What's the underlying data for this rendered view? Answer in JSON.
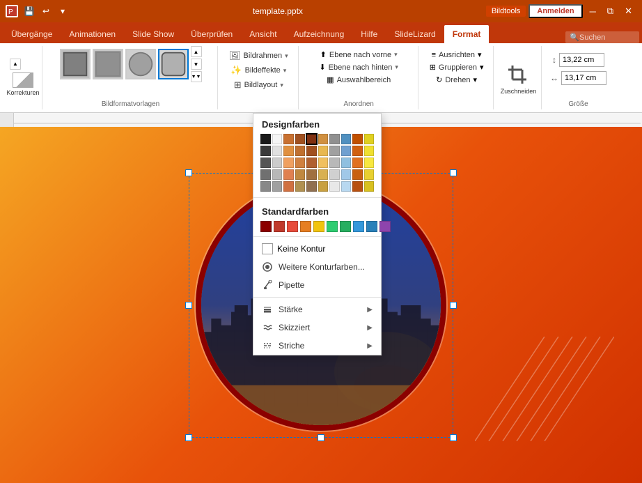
{
  "titlebar": {
    "filename": "template.pptx",
    "bildtools": "Bildtools",
    "anmelden": "Anmelden"
  },
  "tabs": [
    {
      "label": "Übergänge",
      "active": false
    },
    {
      "label": "Animationen",
      "active": false
    },
    {
      "label": "Slide Show",
      "active": false
    },
    {
      "label": "Überprüfen",
      "active": false
    },
    {
      "label": "Ansicht",
      "active": false
    },
    {
      "label": "Aufzeichnung",
      "active": false
    },
    {
      "label": "Hilfe",
      "active": false
    },
    {
      "label": "SlideLizard",
      "active": false
    },
    {
      "label": "Format",
      "active": true
    }
  ],
  "search": {
    "placeholder": "Suchen"
  },
  "ribbon": {
    "bildformatvorlagen": "Bildformatvorlagen",
    "bildrahmen": "Bildrahmen",
    "ebene_vorne": "Ebene nach vorne",
    "ebene_hinten": "Ebene nach hinten",
    "auswahlbereich": "Auswahlbereich",
    "anordnen": "Anordnen",
    "groesse": "Größe",
    "zuschneiden": "Zuschneiden",
    "width_value": "13,22 cm",
    "height_value": "13,17 cm"
  },
  "dropdown": {
    "designfarben_title": "Designfarben",
    "standardfarben_title": "Standardfarben",
    "keine_kontur": "Keine Kontur",
    "weitere": "Weitere Konturfarben...",
    "pipette": "Pipette",
    "staerke": "Stärke",
    "skizziert": "Skizziert",
    "striche": "Striche",
    "designfarben": [
      [
        "#1a1a1a",
        "#f5f5f5",
        "#efefef",
        "#e8e8e8",
        "#d0d0d0"
      ],
      [
        "#c85000",
        "#e8a000",
        "#808080",
        "#5090c0",
        "#c05000"
      ],
      [
        "#d06800",
        "#f0b800",
        "#606060",
        "#4080b0",
        "#d06000"
      ],
      [
        "#e07800",
        "#f8c830",
        "#505050",
        "#3070a0",
        "#e07000"
      ],
      [
        "#b04000",
        "#d89000",
        "#707070",
        "#6090c0",
        "#b05000"
      ],
      [
        "#a03800",
        "#c88000",
        "#808080",
        "#70a0d0",
        "#a04000"
      ],
      [
        "#903000",
        "#b87000",
        "#909090",
        "#80b0e0",
        "#904000"
      ],
      [
        "#802800",
        "#a86000",
        "#a0a0a0",
        "#90b0d0",
        "#803000"
      ],
      [
        "#702000",
        "#985000",
        "#b0b0b0",
        "#a0c0e0",
        "#702800"
      ],
      [
        "#601800",
        "#884000",
        "#c0c0c0",
        "#b0d0f0",
        "#601800"
      ]
    ],
    "standardfarben": [
      "#8b0000",
      "#c0392b",
      "#e74c3c",
      "#e67e22",
      "#f1c40f",
      "#2ecc71",
      "#27ae60",
      "#3498db",
      "#2980b9",
      "#9b59b6",
      "#8e44ad",
      "#2c3e50"
    ]
  }
}
